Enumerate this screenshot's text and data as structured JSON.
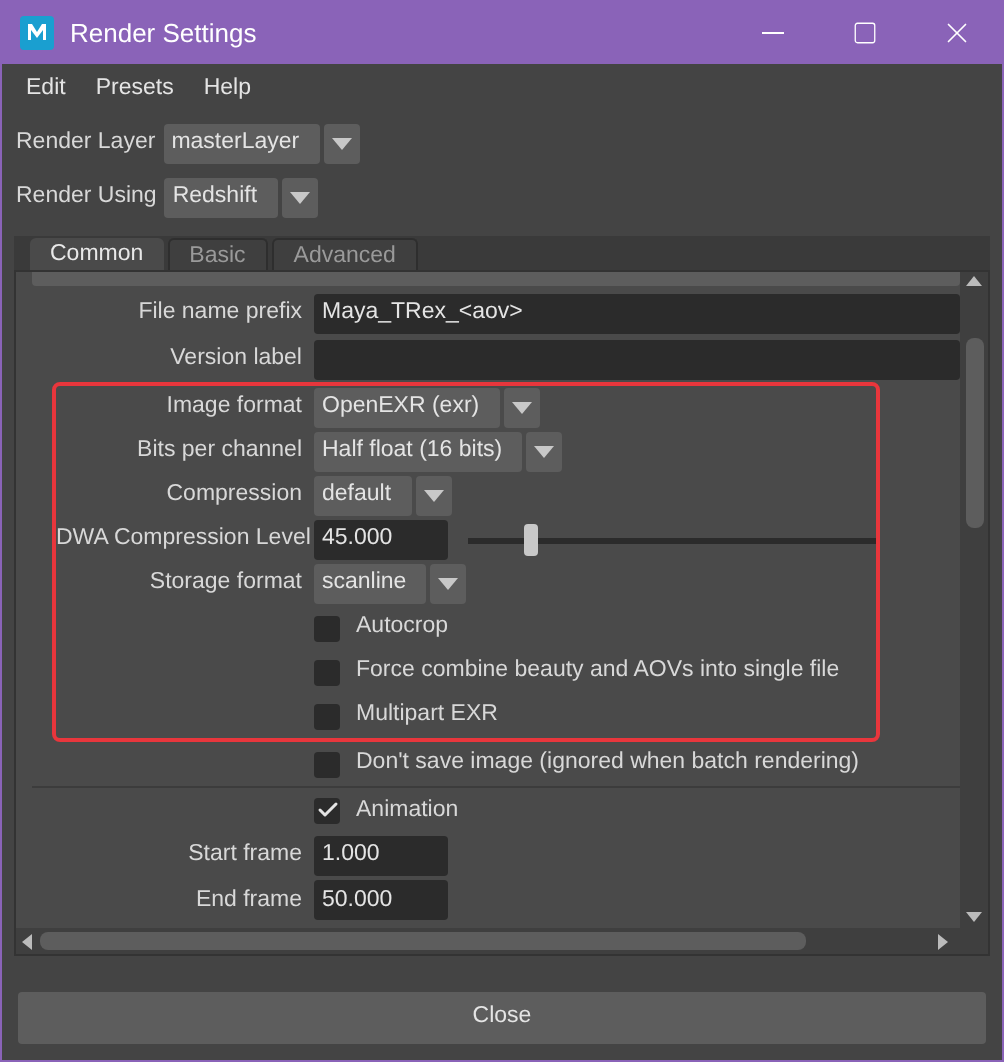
{
  "window": {
    "title": "Render Settings"
  },
  "menu": [
    "Edit",
    "Presets",
    "Help"
  ],
  "render_layer": {
    "label": "Render Layer",
    "value": "masterLayer"
  },
  "render_using": {
    "label": "Render Using",
    "value": "Redshift"
  },
  "tabs": [
    {
      "label": "Common",
      "selected": true
    },
    {
      "label": "Basic",
      "selected": false
    },
    {
      "label": "Advanced",
      "selected": false
    }
  ],
  "file_output_rows": [
    {
      "kind": "text",
      "label": "File name prefix",
      "value": "Maya_TRex_<aov>"
    },
    {
      "kind": "text",
      "label": "Version label"
    }
  ],
  "highlight_box": {
    "rows": [
      {
        "kind": "dropdown",
        "label": "Image format",
        "value": "OpenEXR (exr)"
      },
      {
        "kind": "dropdown",
        "label": "Bits per channel",
        "value": "Half float (16 bits)"
      },
      {
        "kind": "dropdown",
        "label": "Compression",
        "value": "default"
      },
      {
        "kind": "slider",
        "label": "DWA Compression Level",
        "value": "45.000",
        "level": 0.15
      },
      {
        "kind": "dropdown",
        "label": "Storage format",
        "value": "scanline"
      },
      {
        "kind": "checkbox",
        "text": "Autocrop",
        "checked": false
      },
      {
        "kind": "checkbox",
        "text": "Force combine beauty and AOVs into single file",
        "checked": false
      },
      {
        "kind": "checkbox",
        "text": "Multipart EXR",
        "checked": false
      }
    ]
  },
  "file_output_rows_after": [
    {
      "kind": "checkbox",
      "text": "Don't save image (ignored when batch rendering)",
      "checked": false
    }
  ],
  "frame_range_rows": [
    {
      "kind": "checkbox",
      "text": "Animation",
      "checked": true
    },
    {
      "kind": "number",
      "label": "Start frame",
      "value": "1.000"
    },
    {
      "kind": "number",
      "label": "End frame",
      "value": "50.000"
    }
  ],
  "close_button": "Close"
}
